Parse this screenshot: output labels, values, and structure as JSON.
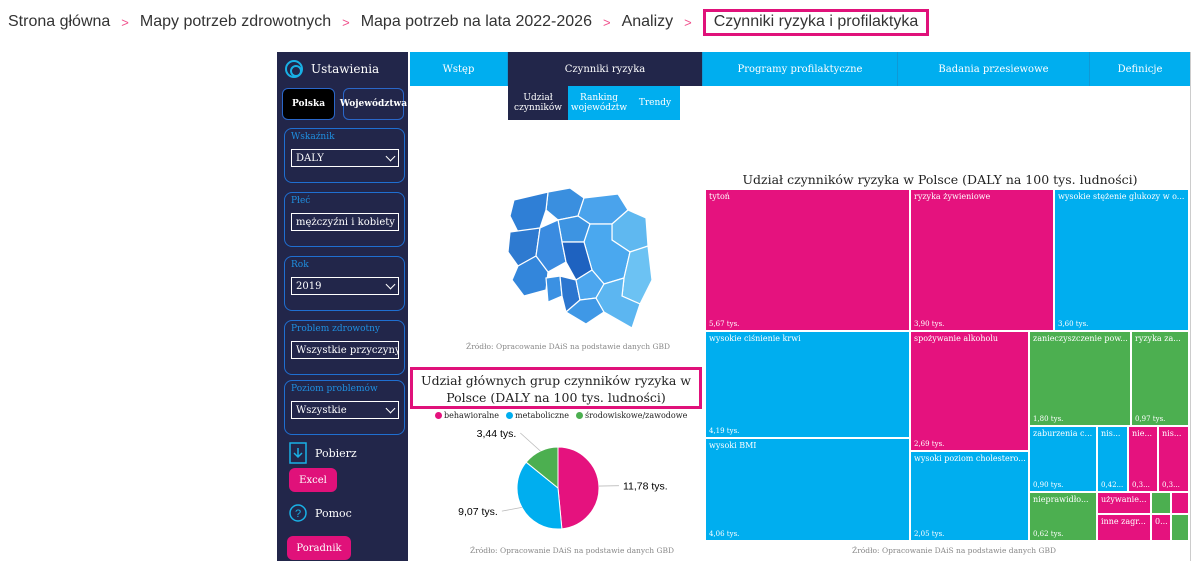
{
  "breadcrumb": {
    "items": [
      "Strona główna",
      "Mapy potrzeb zdrowotnych",
      "Mapa potrzeb na lata 2022-2026",
      "Analizy"
    ],
    "current": "Czynniki ryzyka i profilaktyka",
    "sep": ">"
  },
  "sidebar": {
    "title": "Ustawienia",
    "scope_options": [
      "Polska",
      "Województwa"
    ],
    "selected_scope": "Polska",
    "filters": [
      {
        "label": "Wskaźnik",
        "value": "DALY"
      },
      {
        "label": "Płeć",
        "value": "mężczyźni i kobiety"
      },
      {
        "label": "Rok",
        "value": "2019"
      },
      {
        "label": "Problem zdrowotny",
        "value": "Wszystkie przyczyny"
      },
      {
        "label": "Poziom problemów",
        "value": "Wszystkie"
      }
    ],
    "download_label": "Pobierz",
    "excel_label": "Excel",
    "help_label": "Pomoc",
    "guide_label": "Poradnik"
  },
  "tabs": [
    {
      "label": "Wstęp",
      "active": false
    },
    {
      "label": "Czynniki ryzyka",
      "active": true
    },
    {
      "label": "Programy profilaktyczne",
      "active": false
    },
    {
      "label": "Badania przesiewowe",
      "active": false
    },
    {
      "label": "Definicje",
      "active": false
    }
  ],
  "subtabs": [
    {
      "label": "Udział czynników",
      "active": true
    },
    {
      "label": "Ranking województw",
      "active": false
    },
    {
      "label": "Trendy",
      "active": false
    }
  ],
  "map": {
    "source": "Źródło: Opracowanie DAiS na podstawie danych GBD"
  },
  "treemap": {
    "title": "Udział czynników ryzyka w Polsce (DALY na 100 tys. ludności)",
    "source": "Źródło: Opracowanie DAiS na podstawie danych GBD",
    "colors": {
      "pink": "#e5127e",
      "blue": "#00aeef",
      "green": "#4caf50"
    },
    "cells": [
      {
        "name": "tytoń",
        "value": "5,67 tys.",
        "color": "pink"
      },
      {
        "name": "ryzyka żywieniowe",
        "value": "3,90 tys.",
        "color": "pink"
      },
      {
        "name": "wysokie stężenie glukozy w o...",
        "value": "3,60 tys.",
        "color": "blue"
      },
      {
        "name": "wysokie ciśnienie krwi",
        "value": "4,19 tys.",
        "color": "blue"
      },
      {
        "name": "spożywanie alkoholu",
        "value": "2,69 tys.",
        "color": "pink"
      },
      {
        "name": "zanieczyszczenie pow...",
        "value": "1,80 tys.",
        "color": "green"
      },
      {
        "name": "ryzyka za...",
        "value": "0,97 tys.",
        "color": "green"
      },
      {
        "name": "wysoki BMI",
        "value": "4,06 tys.",
        "color": "blue"
      },
      {
        "name": "wysoki poziom cholestero...",
        "value": "2,05 tys.",
        "color": "blue"
      },
      {
        "name": "zaburzenia c...",
        "value": "0,90 tys.",
        "color": "blue"
      },
      {
        "name": "nis...",
        "value": "0,42...",
        "color": "blue"
      },
      {
        "name": "nie...",
        "value": "0,3...",
        "color": "pink"
      },
      {
        "name": "nis...",
        "value": "0,3...",
        "color": "pink"
      },
      {
        "name": "nieprawidło...",
        "value": "0,62 tys.",
        "color": "green"
      },
      {
        "name": "używanie...",
        "value": "",
        "color": "pink"
      },
      {
        "name": "inne zagr...",
        "value": "",
        "color": "pink"
      },
      {
        "name": "0...",
        "value": "",
        "color": "pink"
      },
      {
        "name": "",
        "value": "",
        "color": "green"
      },
      {
        "name": "",
        "value": "",
        "color": "pink"
      },
      {
        "name": "",
        "value": "",
        "color": "green"
      }
    ]
  },
  "pie": {
    "title": "Udział głównych grup czynników ryzyka w Polsce (DALY na 100 tys. ludności)",
    "legend": [
      "behawioralne",
      "metaboliczne",
      "środowiskowe/zawodowe"
    ],
    "source": "Źródło: Opracowanie DAiS na podstawie danych GBD",
    "colors": [
      "#e5127e",
      "#00aeef",
      "#4caf50"
    ]
  },
  "chart_data": {
    "type": "pie",
    "title": "Udział głównych grup czynników ryzyka w Polsce (DALY na 100 tys. ludności)",
    "categories": [
      "behawioralne",
      "metaboliczne",
      "środowiskowe/zawodowe"
    ],
    "values": [
      11.78,
      9.07,
      3.44
    ],
    "labels": [
      "11,78 tys.",
      "9,07 tys.",
      "3,44 tys."
    ]
  }
}
